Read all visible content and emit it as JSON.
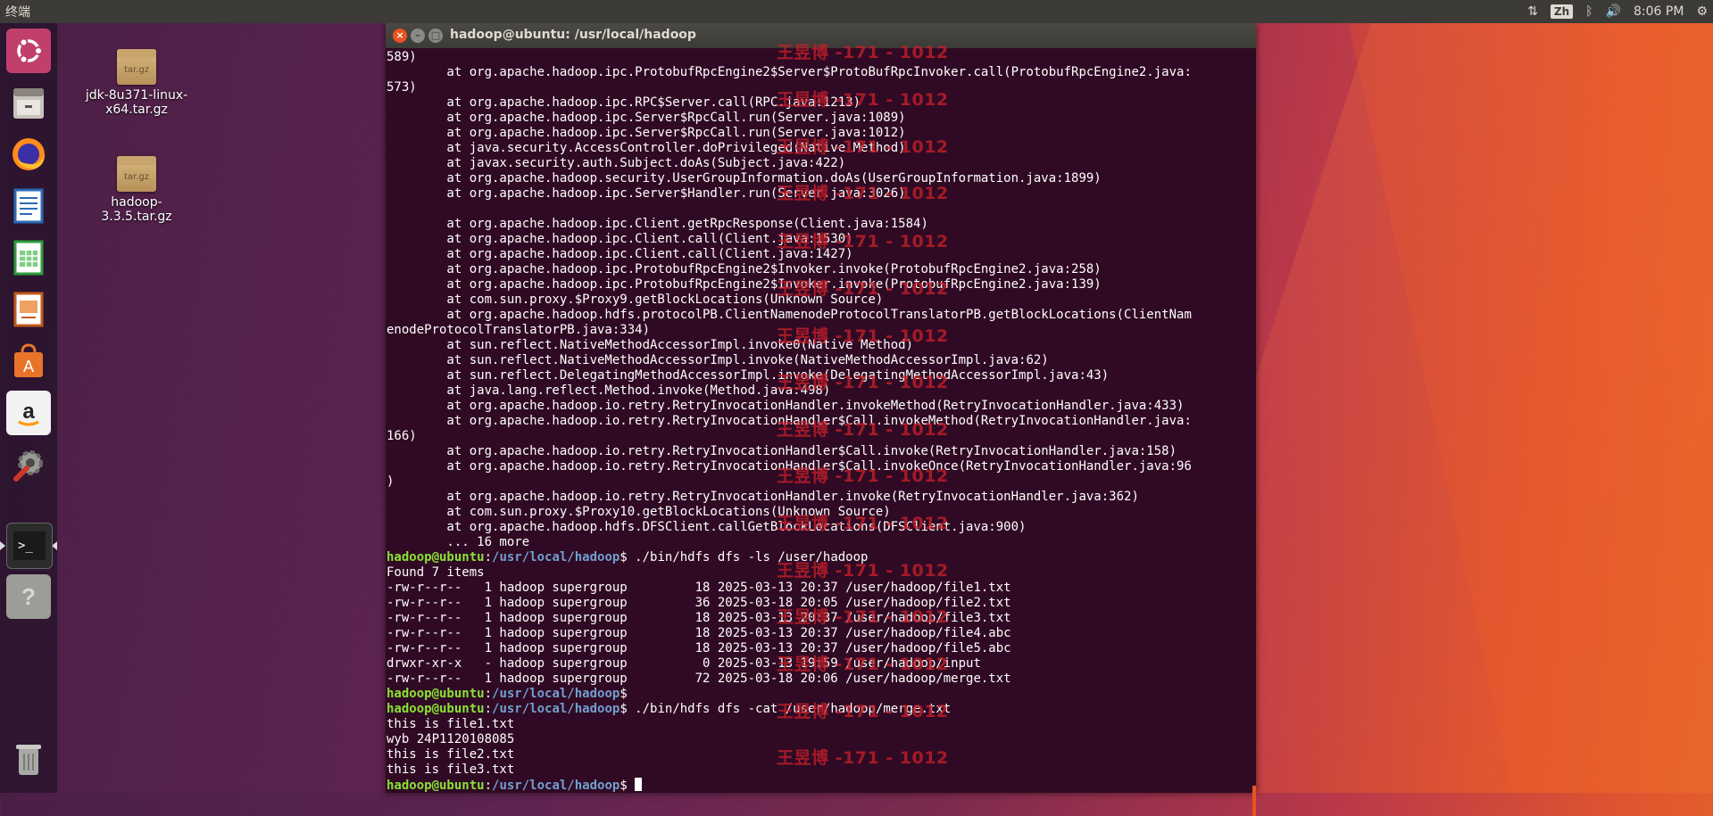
{
  "top_panel": {
    "title": "终端",
    "input_method": "Zh",
    "clock": "8:06 PM"
  },
  "launcher": {
    "items": [
      {
        "name": "ubuntu-dash",
        "icon": "ubuntu-logo-icon"
      },
      {
        "name": "files",
        "icon": "file-cabinet-icon"
      },
      {
        "name": "firefox",
        "icon": "firefox-icon"
      },
      {
        "name": "writer",
        "icon": "libreoffice-writer-icon"
      },
      {
        "name": "calc",
        "icon": "libreoffice-calc-icon"
      },
      {
        "name": "impress",
        "icon": "libreoffice-impress-icon"
      },
      {
        "name": "software",
        "icon": "software-center-icon"
      },
      {
        "name": "amazon",
        "icon": "amazon-icon"
      },
      {
        "name": "settings",
        "icon": "system-settings-icon"
      },
      {
        "name": "terminal",
        "icon": "terminal-icon"
      },
      {
        "name": "help",
        "icon": "help-icon"
      },
      {
        "name": "trash",
        "icon": "trash-icon"
      }
    ]
  },
  "desktop": {
    "icons": [
      {
        "label": "jdk-8u371-linux-x64.tar.gz",
        "badge": "tar.gz"
      },
      {
        "label": "hadoop-3.3.5.tar.gz",
        "badge": "tar.gz"
      }
    ]
  },
  "terminal": {
    "title": "hadoop@ubuntu: /usr/local/hadoop",
    "prompt_user": "hadoop@ubuntu",
    "prompt_sep": ":",
    "prompt_path": "/usr/local/hadoop",
    "prompt_end": "$ ",
    "lines": [
      {
        "t": "589)"
      },
      {
        "t": "        at org.apache.hadoop.ipc.ProtobufRpcEngine2$Server$ProtoBufRpcInvoker.call(ProtobufRpcEngine2.java:"
      },
      {
        "t": "573)"
      },
      {
        "t": "        at org.apache.hadoop.ipc.RPC$Server.call(RPC.java:1213)"
      },
      {
        "t": "        at org.apache.hadoop.ipc.Server$RpcCall.run(Server.java:1089)"
      },
      {
        "t": "        at org.apache.hadoop.ipc.Server$RpcCall.run(Server.java:1012)"
      },
      {
        "t": "        at java.security.AccessController.doPrivileged(Native Method)"
      },
      {
        "t": "        at javax.security.auth.Subject.doAs(Subject.java:422)"
      },
      {
        "t": "        at org.apache.hadoop.security.UserGroupInformation.doAs(UserGroupInformation.java:1899)"
      },
      {
        "t": "        at org.apache.hadoop.ipc.Server$Handler.run(Server.java:3026)"
      },
      {
        "t": ""
      },
      {
        "t": "        at org.apache.hadoop.ipc.Client.getRpcResponse(Client.java:1584)"
      },
      {
        "t": "        at org.apache.hadoop.ipc.Client.call(Client.java:1530)"
      },
      {
        "t": "        at org.apache.hadoop.ipc.Client.call(Client.java:1427)"
      },
      {
        "t": "        at org.apache.hadoop.ipc.ProtobufRpcEngine2$Invoker.invoke(ProtobufRpcEngine2.java:258)"
      },
      {
        "t": "        at org.apache.hadoop.ipc.ProtobufRpcEngine2$Invoker.invoke(ProtobufRpcEngine2.java:139)"
      },
      {
        "t": "        at com.sun.proxy.$Proxy9.getBlockLocations(Unknown Source)"
      },
      {
        "t": "        at org.apache.hadoop.hdfs.protocolPB.ClientNamenodeProtocolTranslatorPB.getBlockLocations(ClientNam"
      },
      {
        "t": "enodeProtocolTranslatorPB.java:334)"
      },
      {
        "t": "        at sun.reflect.NativeMethodAccessorImpl.invoke0(Native Method)"
      },
      {
        "t": "        at sun.reflect.NativeMethodAccessorImpl.invoke(NativeMethodAccessorImpl.java:62)"
      },
      {
        "t": "        at sun.reflect.DelegatingMethodAccessorImpl.invoke(DelegatingMethodAccessorImpl.java:43)"
      },
      {
        "t": "        at java.lang.reflect.Method.invoke(Method.java:498)"
      },
      {
        "t": "        at org.apache.hadoop.io.retry.RetryInvocationHandler.invokeMethod(RetryInvocationHandler.java:433)"
      },
      {
        "t": "        at org.apache.hadoop.io.retry.RetryInvocationHandler$Call.invokeMethod(RetryInvocationHandler.java:"
      },
      {
        "t": "166)"
      },
      {
        "t": "        at org.apache.hadoop.io.retry.RetryInvocationHandler$Call.invoke(RetryInvocationHandler.java:158)"
      },
      {
        "t": "        at org.apache.hadoop.io.retry.RetryInvocationHandler$Call.invokeOnce(RetryInvocationHandler.java:96"
      },
      {
        "t": ")"
      },
      {
        "t": "        at org.apache.hadoop.io.retry.RetryInvocationHandler.invoke(RetryInvocationHandler.java:362)"
      },
      {
        "t": "        at com.sun.proxy.$Proxy10.getBlockLocations(Unknown Source)"
      },
      {
        "t": "        at org.apache.hadoop.hdfs.DFSClient.callGetBlockLocations(DFSClient.java:900)"
      },
      {
        "t": "        ... 16 more"
      },
      {
        "prompt": true,
        "t": "./bin/hdfs dfs -ls /user/hadoop"
      },
      {
        "t": "Found 7 items"
      },
      {
        "t": "-rw-r--r--   1 hadoop supergroup         18 2025-03-13 20:37 /user/hadoop/file1.txt"
      },
      {
        "t": "-rw-r--r--   1 hadoop supergroup         36 2025-03-18 20:05 /user/hadoop/file2.txt"
      },
      {
        "t": "-rw-r--r--   1 hadoop supergroup         18 2025-03-13 20:37 /user/hadoop/file3.txt"
      },
      {
        "t": "-rw-r--r--   1 hadoop supergroup         18 2025-03-13 20:37 /user/hadoop/file4.abc"
      },
      {
        "t": "-rw-r--r--   1 hadoop supergroup         18 2025-03-13 20:37 /user/hadoop/file5.abc"
      },
      {
        "t": "drwxr-xr-x   - hadoop supergroup          0 2025-03-13 19:59 /user/hadoop/input"
      },
      {
        "t": "-rw-r--r--   1 hadoop supergroup         72 2025-03-18 20:06 /user/hadoop/merge.txt"
      },
      {
        "prompt": true,
        "t": ""
      },
      {
        "prompt": true,
        "t": "./bin/hdfs dfs -cat /user/hadoop/merge.txt"
      },
      {
        "t": "this is file1.txt"
      },
      {
        "t": "wyb 24P1120108085"
      },
      {
        "t": "this is file2.txt"
      },
      {
        "t": "this is file3.txt"
      },
      {
        "prompt": true,
        "t": "",
        "cursor": true
      }
    ]
  },
  "watermark": {
    "text": "王昱博 -171 - 1012"
  },
  "colors": {
    "terminal_bg": "#300a24",
    "prompt_user": "#8ae234",
    "prompt_path": "#729fcf",
    "accent": "#e95420",
    "watermark": "#c71f2a"
  }
}
